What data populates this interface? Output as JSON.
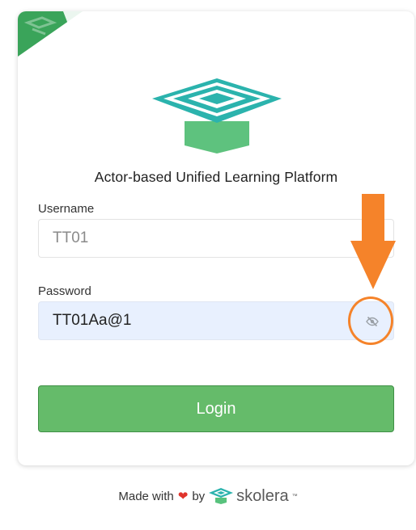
{
  "header": {
    "tagline": "Actor-based Unified Learning Platform"
  },
  "form": {
    "username_label": "Username",
    "username_value": "TT01",
    "password_label": "Password",
    "password_value": "TT01Aa@1",
    "login_label": "Login"
  },
  "footer": {
    "made_with": "Made with",
    "by": "by",
    "brand": "skolera",
    "trademark": "™"
  },
  "icons": {
    "visibility_toggle": "eye-slash-icon",
    "heart": "heart-icon",
    "logo": "skolera-logo-icon"
  },
  "colors": {
    "login_button": "#65bb6a",
    "password_bg": "#e8f0fe",
    "annotation": "#f5832a",
    "brand_teal": "#2bb3ad",
    "brand_green": "#58c27d"
  }
}
